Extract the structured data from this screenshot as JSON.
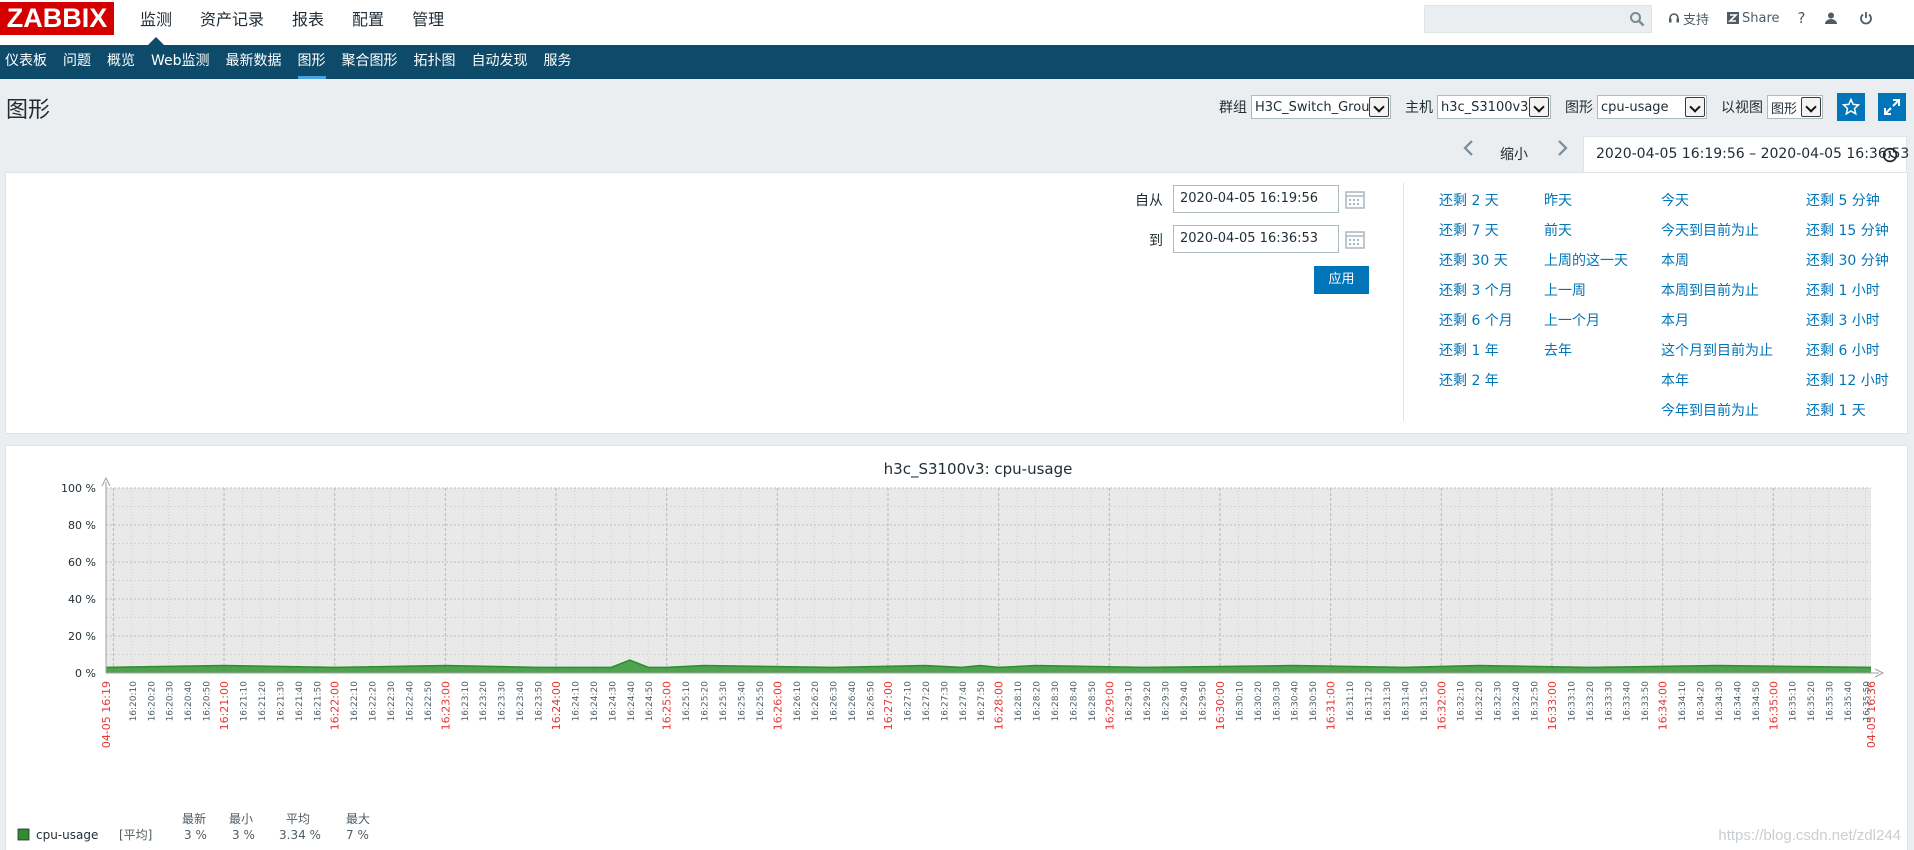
{
  "header": {
    "logo": "ZABBIX",
    "menu": [
      {
        "label": "监测",
        "active": true
      },
      {
        "label": "资产记录",
        "active": false
      },
      {
        "label": "报表",
        "active": false
      },
      {
        "label": "配置",
        "active": false
      },
      {
        "label": "管理",
        "active": false
      }
    ],
    "search": {
      "value": "",
      "placeholder": ""
    },
    "support": "支持",
    "share": "Share",
    "help": "?"
  },
  "subnav": [
    {
      "label": "仪表板",
      "active": false
    },
    {
      "label": "问题",
      "active": false
    },
    {
      "label": "概览",
      "active": false
    },
    {
      "label": "Web监测",
      "active": false
    },
    {
      "label": "最新数据",
      "active": false
    },
    {
      "label": "图形",
      "active": true
    },
    {
      "label": "聚合图形",
      "active": false
    },
    {
      "label": "拓扑图",
      "active": false
    },
    {
      "label": "自动发现",
      "active": false
    },
    {
      "label": "服务",
      "active": false
    }
  ],
  "page": {
    "title": "图形",
    "filters": {
      "group_label": "群组",
      "group_value": "H3C_Switch_Group",
      "host_label": "主机",
      "host_value": "h3c_S3100v3",
      "graph_label": "图形",
      "graph_value": "cpu-usage",
      "view_label": "以视图",
      "view_value": "图形"
    }
  },
  "timenav": {
    "zoom_out": "缩小",
    "range": "2020-04-05 16:19:56 – 2020-04-05 16:36:53"
  },
  "timefilter": {
    "from_label": "自从",
    "from_value": "2020-04-05 16:19:56",
    "to_label": "到",
    "to_value": "2020-04-05 16:36:53",
    "apply": "应用",
    "quick": [
      [
        "还剩 2 天",
        "还剩 7 天",
        "还剩 30 天",
        "还剩 3 个月",
        "还剩 6 个月",
        "还剩 1 年",
        "还剩 2 年"
      ],
      [
        "昨天",
        "前天",
        "上周的这一天",
        "上一周",
        "上一个月",
        "去年"
      ],
      [
        "今天",
        "今天到目前为止",
        "本周",
        "本周到目前为止",
        "本月",
        "这个月到目前为止",
        "本年",
        "今年到目前为止"
      ],
      [
        "还剩 5 分钟",
        "还剩 15 分钟",
        "还剩 30 分钟",
        "还剩 1 小时",
        "还剩 3 小时",
        "还剩 6 小时",
        "还剩 12 小时",
        "还剩 1 天"
      ]
    ]
  },
  "chart_data": {
    "type": "area",
    "title": "h3c_S3100v3: cpu-usage",
    "ylim": [
      0,
      100
    ],
    "yticks": [
      "100 %",
      "80 %",
      "60 %",
      "40 %",
      "20 %",
      "0 %"
    ],
    "x_start_label": "04-05 16:19",
    "x_end_label": "04-05 16:36",
    "x_minute_labels": [
      "16:21:00",
      "16:22:00",
      "16:23:00",
      "16:24:00",
      "16:25:00",
      "16:26:00",
      "16:27:00",
      "16:28:00",
      "16:29:00",
      "16:30:00",
      "16:31:00",
      "16:32:00",
      "16:33:00",
      "16:34:00",
      "16:35:00",
      "16:36:00"
    ],
    "x_minutes": [
      21,
      22,
      23,
      24,
      25,
      26,
      27,
      28,
      29,
      30,
      31,
      32,
      33,
      34,
      35,
      36
    ],
    "x_range_seconds": [
      56,
      1013
    ],
    "series": [
      {
        "name": "cpu-usage",
        "color": "#2f8f2f",
        "fill": "#3e9b3e",
        "x_seconds": [
          56,
          120,
          180,
          240,
          290,
          330,
          340,
          350,
          360,
          380,
          450,
          500,
          520,
          530,
          540,
          560,
          620,
          700,
          760,
          800,
          860,
          930,
          1013
        ],
        "values": [
          3,
          4,
          3,
          4,
          3,
          3,
          7,
          3,
          3,
          4,
          3,
          4,
          3,
          4,
          3,
          4,
          3,
          4,
          3,
          4,
          3,
          4,
          3
        ]
      }
    ],
    "legend": {
      "headers": [
        "最新",
        "最小",
        "平均",
        "最大"
      ],
      "name": "cpu-usage",
      "func": "[平均]",
      "last": "3 %",
      "min": "3 %",
      "avg": "3.34 %",
      "max": "7 %"
    }
  },
  "watermark": "https://blog.csdn.net/zdl244"
}
